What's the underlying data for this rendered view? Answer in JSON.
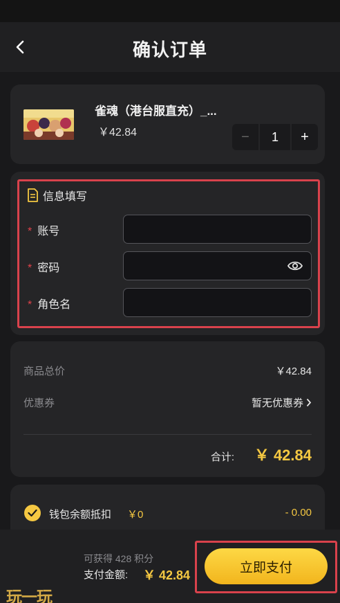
{
  "header": {
    "title": "确认订单"
  },
  "product": {
    "name": "雀魂（港台服直充）_...",
    "price": "￥42.84",
    "quantity": "1",
    "minus": "−",
    "plus": "+"
  },
  "form": {
    "section_title": "信息填写",
    "required_mark": "*",
    "fields": [
      {
        "label": "账号",
        "value": ""
      },
      {
        "label": "密码",
        "value": ""
      },
      {
        "label": "角色名",
        "value": ""
      }
    ]
  },
  "summary": {
    "goods_total_label": "商品总价",
    "goods_total_value": "￥42.84",
    "coupon_label": "优惠券",
    "coupon_value": "暂无优惠券",
    "total_label": "合计:",
    "total_value": "￥ 42.84"
  },
  "wallet": {
    "label": "钱包余额抵扣",
    "balance": "￥0",
    "deduct": "- 0.00"
  },
  "footer": {
    "earn_text": "可获得 428 积分",
    "pay_label": "支付金额:",
    "pay_amount": "￥ 42.84",
    "pay_button": "立即支付"
  },
  "watermark": "玩一玩",
  "colors": {
    "accent": "#f5c842",
    "highlight": "#d9424c",
    "required": "#e0424a"
  }
}
